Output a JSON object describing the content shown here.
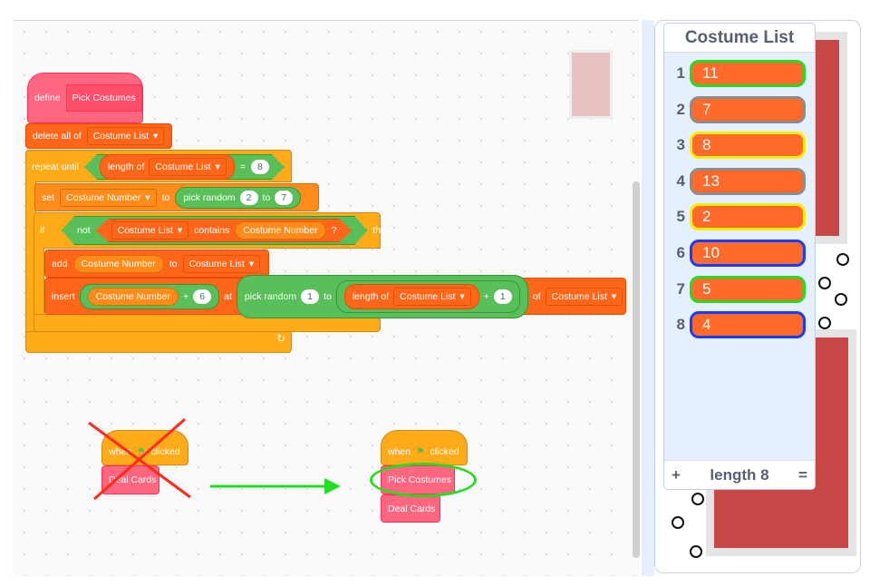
{
  "script": {
    "define_label": "define",
    "define_name": "Pick Costumes",
    "delete_label": "delete all of",
    "list_name": "Costume List",
    "repeat_label": "repeat until",
    "length_of": "length of",
    "equals": "=",
    "repeat_target": "8",
    "set_label": "set",
    "var_name": "Costume Number",
    "to": "to",
    "pick_random": "pick random",
    "rand_from": "2",
    "rand_to": "7",
    "if_label": "if",
    "not_label": "not",
    "contains": "contains",
    "question": "?",
    "then": "then",
    "add_label": "add",
    "insert_label": "insert",
    "plus": "+",
    "offset": "6",
    "at": "at",
    "rand_from2": "1",
    "plus_one": "1",
    "of": "of",
    "dropdown_arrow": "▾",
    "loop_arrow": "↻"
  },
  "old_script": {
    "hat": "when",
    "clicked": "clicked",
    "call": "Deal Cards",
    "flag_icon": "green-flag"
  },
  "new_script": {
    "hat": "when",
    "clicked": "clicked",
    "call1": "Pick Costumes",
    "call2": "Deal Cards",
    "flag_icon": "green-flag"
  },
  "annotations": {
    "cross_color": "#ff2a1a",
    "arrow_color": "#22dd22",
    "highlight_color": "#22dd22"
  },
  "list_monitor": {
    "title": "Costume List",
    "items": [
      {
        "index": "1",
        "value": "11",
        "outline": "#22dd22"
      },
      {
        "index": "2",
        "value": "7",
        "outline": "#8c8c8c"
      },
      {
        "index": "3",
        "value": "8",
        "outline": "#f5ee00"
      },
      {
        "index": "4",
        "value": "13",
        "outline": "#8c8c8c"
      },
      {
        "index": "5",
        "value": "2",
        "outline": "#f5ee00"
      },
      {
        "index": "6",
        "value": "10",
        "outline": "#1a3cff"
      },
      {
        "index": "7",
        "value": "5",
        "outline": "#22dd22"
      },
      {
        "index": "8",
        "value": "4",
        "outline": "#1a3cff"
      }
    ],
    "add_button": "+",
    "length_label": "length 8",
    "resize_handle": "="
  }
}
